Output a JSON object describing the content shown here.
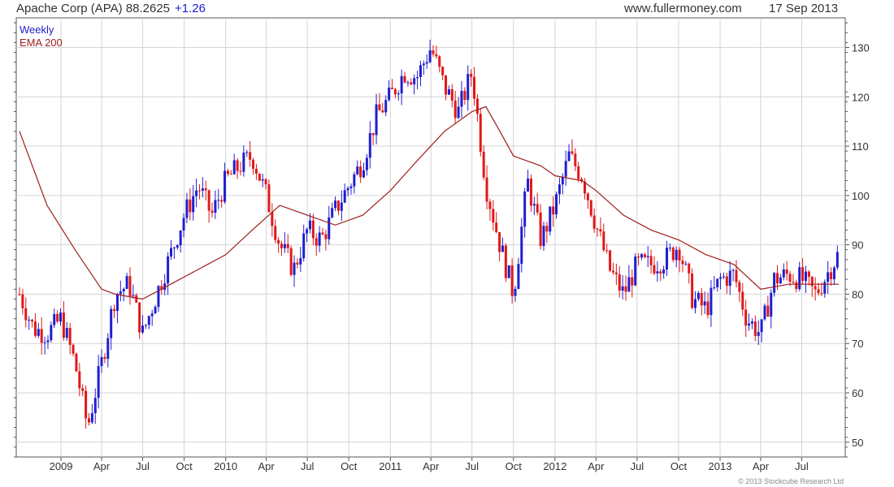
{
  "header": {
    "title": "Apache Corp (APA) 88.2625",
    "change": "+1.26",
    "site": "www.fullermoney.com",
    "date": "17 Sep 2013"
  },
  "legend": {
    "weekly": "Weekly",
    "ema": "EMA 200"
  },
  "copyright": "© 2013 Stockcube Research Ltd",
  "colors": {
    "up": "#1f1fd0",
    "down": "#e01818",
    "ema": "#a01c1c",
    "grid": "#d4d4d4",
    "axis": "#555555"
  },
  "chart_data": {
    "type": "candlestick",
    "ylim": [
      47,
      136
    ],
    "yticks": [
      50,
      60,
      70,
      80,
      90,
      100,
      110,
      120,
      130
    ],
    "x_range": [
      "2008-10-01",
      "2013-09-21"
    ],
    "xticks": [
      {
        "date": "2009-01-01",
        "label": "2009"
      },
      {
        "date": "2009-04-01",
        "label": "Apr"
      },
      {
        "date": "2009-07-01",
        "label": "Jul"
      },
      {
        "date": "2009-10-01",
        "label": "Oct"
      },
      {
        "date": "2010-01-01",
        "label": "2010"
      },
      {
        "date": "2010-04-01",
        "label": "Apr"
      },
      {
        "date": "2010-07-01",
        "label": "Jul"
      },
      {
        "date": "2010-10-01",
        "label": "Oct"
      },
      {
        "date": "2011-01-01",
        "label": "2011"
      },
      {
        "date": "2011-04-01",
        "label": "Apr"
      },
      {
        "date": "2011-07-01",
        "label": "Jul"
      },
      {
        "date": "2011-10-01",
        "label": "Oct"
      },
      {
        "date": "2012-01-01",
        "label": "2012"
      },
      {
        "date": "2012-04-01",
        "label": "Apr"
      },
      {
        "date": "2012-07-01",
        "label": "Jul"
      },
      {
        "date": "2012-10-01",
        "label": "Oct"
      },
      {
        "date": "2013-01-01",
        "label": "2013"
      },
      {
        "date": "2013-04-01",
        "label": "Apr"
      },
      {
        "date": "2013-07-01",
        "label": "Jul"
      }
    ],
    "close_anchors": [
      [
        "2008-10-01",
        80
      ],
      [
        "2008-11-01",
        73
      ],
      [
        "2008-12-01",
        72
      ],
      [
        "2009-01-01",
        75
      ],
      [
        "2009-02-01",
        66
      ],
      [
        "2009-03-01",
        53
      ],
      [
        "2009-04-01",
        66
      ],
      [
        "2009-05-01",
        80
      ],
      [
        "2009-06-01",
        82
      ],
      [
        "2009-07-01",
        72
      ],
      [
        "2009-08-01",
        80
      ],
      [
        "2009-09-01",
        88
      ],
      [
        "2009-10-01",
        96
      ],
      [
        "2009-11-01",
        102
      ],
      [
        "2009-12-01",
        96
      ],
      [
        "2010-01-01",
        103
      ],
      [
        "2010-02-01",
        106
      ],
      [
        "2010-03-01",
        108
      ],
      [
        "2010-04-01",
        100
      ],
      [
        "2010-05-01",
        90
      ],
      [
        "2010-06-01",
        85
      ],
      [
        "2010-07-01",
        93
      ],
      [
        "2010-08-01",
        91
      ],
      [
        "2010-09-01",
        97
      ],
      [
        "2010-10-01",
        102
      ],
      [
        "2010-11-01",
        107
      ],
      [
        "2010-12-01",
        116
      ],
      [
        "2011-01-01",
        120
      ],
      [
        "2011-02-01",
        125
      ],
      [
        "2011-03-01",
        124
      ],
      [
        "2011-04-01",
        130
      ],
      [
        "2011-05-01",
        122
      ],
      [
        "2011-06-01",
        117
      ],
      [
        "2011-07-01",
        125
      ],
      [
        "2011-08-01",
        102
      ],
      [
        "2011-09-01",
        90
      ],
      [
        "2011-10-01",
        80
      ],
      [
        "2011-11-01",
        103
      ],
      [
        "2011-12-01",
        91
      ],
      [
        "2012-01-01",
        98
      ],
      [
        "2012-02-01",
        108
      ],
      [
        "2012-03-01",
        104
      ],
      [
        "2012-04-01",
        94
      ],
      [
        "2012-05-01",
        85
      ],
      [
        "2012-06-01",
        80
      ],
      [
        "2012-07-01",
        86
      ],
      [
        "2012-08-01",
        86
      ],
      [
        "2012-09-01",
        87
      ],
      [
        "2012-10-01",
        90
      ],
      [
        "2012-11-01",
        79
      ],
      [
        "2012-12-01",
        77
      ],
      [
        "2013-01-01",
        83
      ],
      [
        "2013-02-01",
        84
      ],
      [
        "2013-03-01",
        75
      ],
      [
        "2013-04-01",
        72
      ],
      [
        "2013-05-01",
        83
      ],
      [
        "2013-06-01",
        84
      ],
      [
        "2013-07-01",
        83
      ],
      [
        "2013-08-01",
        80
      ],
      [
        "2013-09-21",
        88.26
      ]
    ],
    "ema_200": [
      [
        "2008-10-01",
        113
      ],
      [
        "2008-12-01",
        98
      ],
      [
        "2009-02-01",
        89
      ],
      [
        "2009-04-01",
        81
      ],
      [
        "2009-05-01",
        80
      ],
      [
        "2009-07-01",
        79
      ],
      [
        "2009-09-01",
        82
      ],
      [
        "2009-11-01",
        85
      ],
      [
        "2010-01-01",
        88
      ],
      [
        "2010-03-01",
        93
      ],
      [
        "2010-05-01",
        98
      ],
      [
        "2010-07-01",
        96
      ],
      [
        "2010-09-01",
        94
      ],
      [
        "2010-11-01",
        96
      ],
      [
        "2011-01-01",
        101
      ],
      [
        "2011-03-01",
        107
      ],
      [
        "2011-05-01",
        113
      ],
      [
        "2011-07-01",
        117
      ],
      [
        "2011-08-01",
        118
      ],
      [
        "2011-09-01",
        113
      ],
      [
        "2011-10-01",
        108
      ],
      [
        "2011-12-01",
        106
      ],
      [
        "2012-01-01",
        104
      ],
      [
        "2012-03-01",
        103
      ],
      [
        "2012-04-01",
        101
      ],
      [
        "2012-06-01",
        96
      ],
      [
        "2012-08-01",
        93
      ],
      [
        "2012-10-01",
        91
      ],
      [
        "2012-12-01",
        88
      ],
      [
        "2013-02-01",
        86
      ],
      [
        "2013-04-01",
        81
      ],
      [
        "2013-06-01",
        82
      ],
      [
        "2013-09-21",
        82
      ]
    ]
  }
}
